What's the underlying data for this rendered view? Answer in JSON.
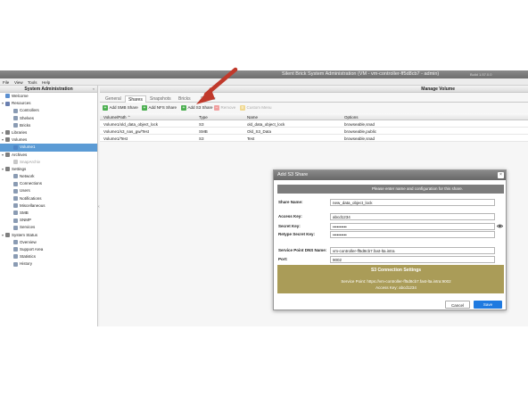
{
  "window": {
    "title": "Silent Brick System Administration (VM - vm-controller-ff5d8cb7 - admin)",
    "build": "Build 1.57.0.0"
  },
  "menu": [
    "File",
    "View",
    "Tools",
    "Help"
  ],
  "sidebar": {
    "header": "System Administration",
    "items": [
      {
        "label": "Welcome",
        "level": 0,
        "twisty": "",
        "icon": "welcome-icon",
        "color": "#5b8fd0"
      },
      {
        "label": "Resources",
        "level": 0,
        "twisty": "▾",
        "icon": "resources-icon",
        "color": "#6a7fb0"
      },
      {
        "label": "Controllers",
        "level": 1,
        "twisty": "",
        "icon": "controller-icon",
        "color": "#8a9bb3"
      },
      {
        "label": "Shelves",
        "level": 1,
        "twisty": "",
        "icon": "shelf-icon",
        "color": "#8a9bb3"
      },
      {
        "label": "Bricks",
        "level": 1,
        "twisty": "",
        "icon": "brick-icon",
        "color": "#8a9bb3"
      },
      {
        "label": "Libraries",
        "level": 0,
        "twisty": "▸",
        "icon": "libraries-icon",
        "color": "#7f7f7f"
      },
      {
        "label": "Volumes",
        "level": 0,
        "twisty": "▾",
        "icon": "volumes-icon",
        "color": "#7f7f7f"
      },
      {
        "label": "Volume1",
        "level": 1,
        "twisty": "",
        "icon": "volume-icon",
        "color": "#4f86c6",
        "selected": true
      },
      {
        "label": "Archives",
        "level": 0,
        "twisty": "▾",
        "icon": "archives-icon",
        "color": "#7f7f7f"
      },
      {
        "label": "SnapArchiv",
        "level": 1,
        "twisty": "",
        "icon": "archive-icon",
        "color": "#c8c8c8",
        "dim": true
      },
      {
        "label": "Settings",
        "level": 0,
        "twisty": "▾",
        "icon": "gear-icon",
        "color": "#7f7f7f"
      },
      {
        "label": "Network",
        "level": 1,
        "twisty": "",
        "icon": "network-icon",
        "color": "#8a9bb3"
      },
      {
        "label": "Connections",
        "level": 1,
        "twisty": "",
        "icon": "connections-icon",
        "color": "#8a9bb3"
      },
      {
        "label": "Users",
        "level": 1,
        "twisty": "",
        "icon": "users-icon",
        "color": "#8a9bb3"
      },
      {
        "label": "Notifications",
        "level": 1,
        "twisty": "",
        "icon": "notifications-icon",
        "color": "#8a9bb3"
      },
      {
        "label": "Miscellaneous",
        "level": 1,
        "twisty": "",
        "icon": "misc-icon",
        "color": "#8a9bb3"
      },
      {
        "label": "SMB",
        "level": 1,
        "twisty": "",
        "icon": "smb-icon",
        "color": "#8a9bb3"
      },
      {
        "label": "SNMP",
        "level": 1,
        "twisty": "",
        "icon": "snmp-icon",
        "color": "#8a9bb3"
      },
      {
        "label": "Services",
        "level": 1,
        "twisty": "",
        "icon": "services-icon",
        "color": "#8a9bb3"
      },
      {
        "label": "System Status",
        "level": 0,
        "twisty": "▾",
        "icon": "status-icon",
        "color": "#7f7f7f"
      },
      {
        "label": "Overview",
        "level": 1,
        "twisty": "",
        "icon": "overview-icon",
        "color": "#8a9bb3"
      },
      {
        "label": "Support Area",
        "level": 1,
        "twisty": "",
        "icon": "support-icon",
        "color": "#8a9bb3"
      },
      {
        "label": "Statistics",
        "level": 1,
        "twisty": "",
        "icon": "statistics-icon",
        "color": "#8a9bb3"
      },
      {
        "label": "History",
        "level": 1,
        "twisty": "",
        "icon": "history-icon",
        "color": "#8a9bb3"
      }
    ]
  },
  "main": {
    "header": "Manage Volume",
    "tabs": [
      "General",
      "Shares",
      "Snapshots",
      "Bricks",
      "Service"
    ],
    "active_tab": "Shares",
    "toolbar": [
      {
        "label": "Add SMB Share",
        "icon": "plus-icon",
        "color": "#4caf50",
        "symbol": "+",
        "disabled": false
      },
      {
        "label": "Add NFS Share",
        "icon": "plus-icon",
        "color": "#4caf50",
        "symbol": "+",
        "disabled": false
      },
      {
        "label": "Add S3 Share",
        "icon": "plus-icon",
        "color": "#4caf50",
        "symbol": "+",
        "disabled": false
      },
      {
        "label": "Remove",
        "icon": "minus-icon",
        "color": "#f0a0a0",
        "symbol": "−",
        "disabled": true
      },
      {
        "label": "Custom Menu",
        "icon": "menu-icon",
        "color": "#f0d890",
        "symbol": "≡",
        "disabled": true
      }
    ],
    "columns": [
      "Volume/Path ⌃",
      "Type",
      "Name",
      "Options"
    ],
    "rows": [
      [
        "Volume1/old_data_object_lock",
        "S3",
        "old_data_object_lock",
        "browseable,snad"
      ],
      [
        "Volume1/s3_nas_gw/Test",
        "SMB",
        "Old_S3_Data",
        "browseable,public"
      ],
      [
        "Volume1/Test",
        "S3",
        "Test",
        "browseable,snad"
      ]
    ]
  },
  "dialog": {
    "title": "Add S3 Share",
    "close_symbol": "×",
    "info": "Please enter name and configuration for this share.",
    "fields": {
      "share_name": {
        "label": "Share Name:",
        "value": "new_data_object_lock"
      },
      "access_key": {
        "label": "Access Key:",
        "value": "abcd1234"
      },
      "secret_key": {
        "label": "Secret Key:",
        "value": "••••••••••"
      },
      "retype_secret": {
        "label": "Retype Secret Key:",
        "value": "••••••••••"
      },
      "dns_name": {
        "label": "Service Point DNS Name:",
        "value": "vm-controller-ff5d8cb7.fast-lta.intra"
      },
      "port": {
        "label": "Port:",
        "value": "9002"
      }
    },
    "s3_box": {
      "heading": "S3 Connection Settings",
      "service_point": "Service Point: https://vm-controller-ff5d8cb7.fast-lta.intra:9002",
      "access_key": "Access Key: abcd1234",
      "color": "#aa9c58"
    },
    "cancel_label": "Cancel",
    "save_label": "Save"
  },
  "annotation": {
    "arrow_color": "#c0392b"
  }
}
